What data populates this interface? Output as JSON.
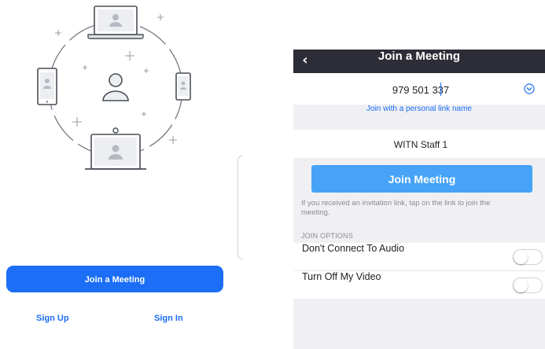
{
  "left": {
    "join_button_label": "Join a Meeting",
    "sign_up_label": "Sign Up",
    "sign_in_label": "Sign In"
  },
  "right": {
    "nav": {
      "title": "Join a Meeting",
      "back_icon": "chevron-left-icon"
    },
    "meeting_id": {
      "value": "979 501 337"
    },
    "personal_link_label": "Join with a personal link name",
    "display_name": {
      "value": "WITN Staff 1"
    },
    "join_button_label": "Join Meeting",
    "invitation_hint": "If you received an invitation link, tap on the link to join the meeting.",
    "options_header": "JOIN OPTIONS",
    "options": [
      {
        "label": "Don't Connect To Audio",
        "enabled": false
      },
      {
        "label": "Turn Off My Video",
        "enabled": false
      }
    ]
  },
  "colors": {
    "brand_blue": "#1b6ef5",
    "join_meeting_blue": "#46a3f7",
    "nav_bar": "#2d2d37",
    "panel_background": "#f0f0f4"
  }
}
